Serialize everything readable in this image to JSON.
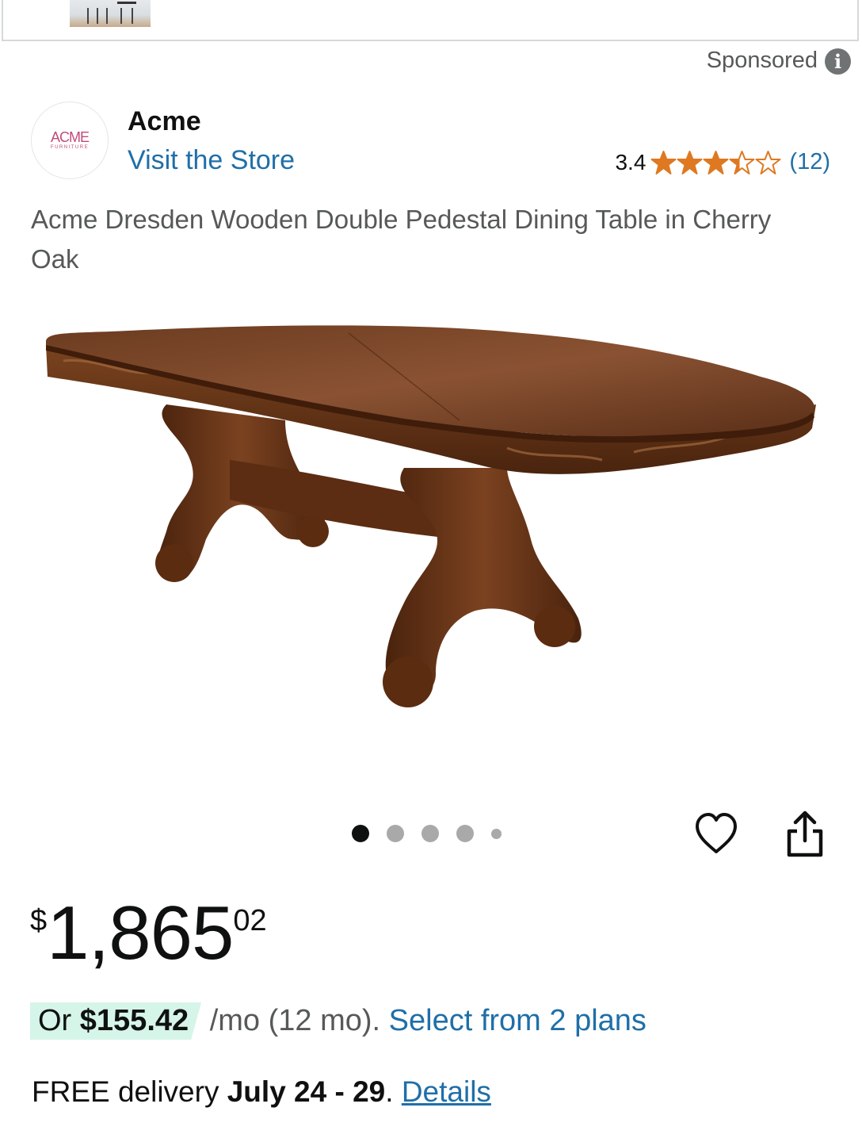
{
  "sponsored": {
    "label": "Sponsored",
    "icon": "info-icon"
  },
  "brand": {
    "logo_text": "ACME",
    "logo_subtext": "FURNITURE",
    "name": "Acme",
    "visit_link": "Visit the Store"
  },
  "rating": {
    "value": "3.4",
    "stars": 3.4,
    "count": "(12)",
    "star_color": "#de7921"
  },
  "product": {
    "title": "Acme Dresden Wooden Double Pedestal Dining Table in Cherry Oak",
    "image_alt": "product-image"
  },
  "carousel": {
    "total": 5,
    "active": 0
  },
  "actions": {
    "wishlist_icon": "heart-icon",
    "share_icon": "share-icon"
  },
  "price": {
    "symbol": "$",
    "whole": "1,865",
    "fraction": "02"
  },
  "financing": {
    "prefix": "Or ",
    "amount": "$155.42",
    "term": " /mo (12 mo). ",
    "link": "Select from 2 plans"
  },
  "delivery": {
    "prefix": "FREE delivery ",
    "dates": "July 24 - 29",
    "separator": ". ",
    "link": "Details"
  },
  "colors": {
    "link": "#1f6fa8",
    "financing_bg": "#d6f5e9",
    "text": "#0f1111",
    "muted": "#565959"
  }
}
